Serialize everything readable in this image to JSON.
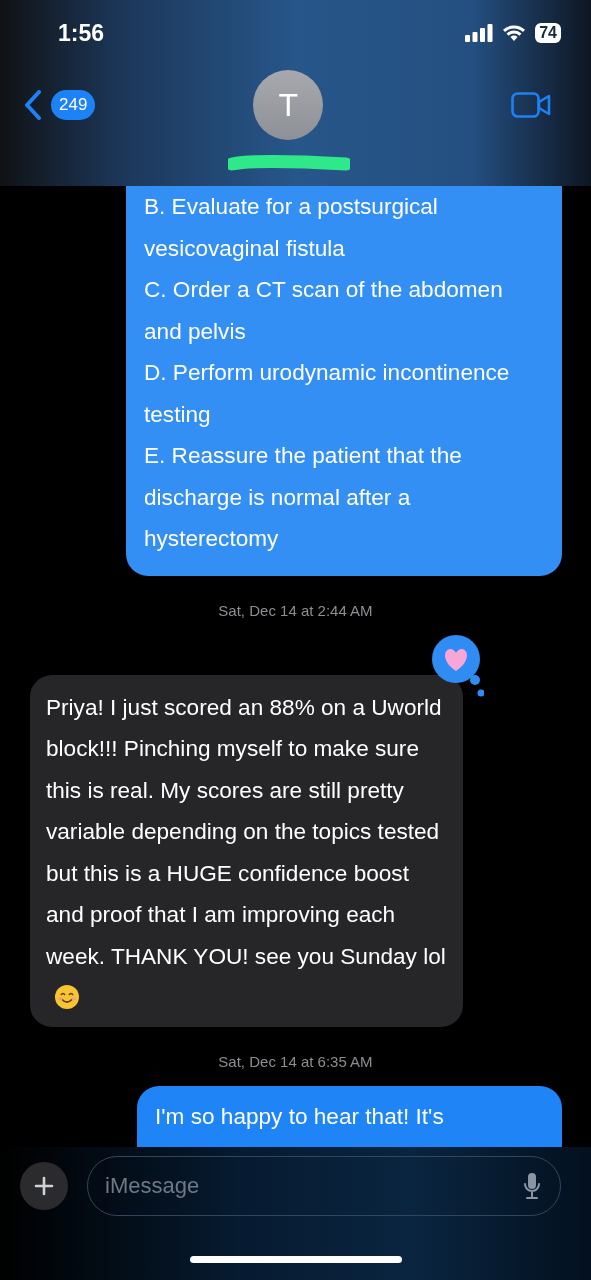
{
  "status_bar": {
    "time": "1:56",
    "battery": "74"
  },
  "header": {
    "unread_count": "249",
    "avatar_initial": "T"
  },
  "messages": [
    {
      "kind": "sent",
      "lines": [
        "B. Evaluate for a postsurgical vesicovaginal fistula",
        "C. Order a CT scan of the abdomen and pelvis",
        "D. Perform urodynamic incontinence testing",
        "E. Reassure the patient that the discharge is normal after a hysterectomy"
      ],
      "cut_top": true
    },
    {
      "kind": "timestamp",
      "text": "Sat, Dec 14 at 2:44 AM"
    },
    {
      "kind": "received",
      "lines": [
        "Priya! I just scored an 88% on a Uworld block!!! Pinching myself to make sure this is real. My scores are still pretty variable depending on the topics tested but this is a HUGE confidence boost and proof that I am improving each week. THANK YOU! see you Sunday lol"
      ],
      "emoji": true,
      "tapback": true
    },
    {
      "kind": "timestamp",
      "text": "Sat, Dec 14 at 6:35 AM"
    },
    {
      "kind": "sent",
      "lines": [
        "I'm so happy to hear that! It's"
      ]
    }
  ],
  "composer": {
    "placeholder": "iMessage"
  }
}
